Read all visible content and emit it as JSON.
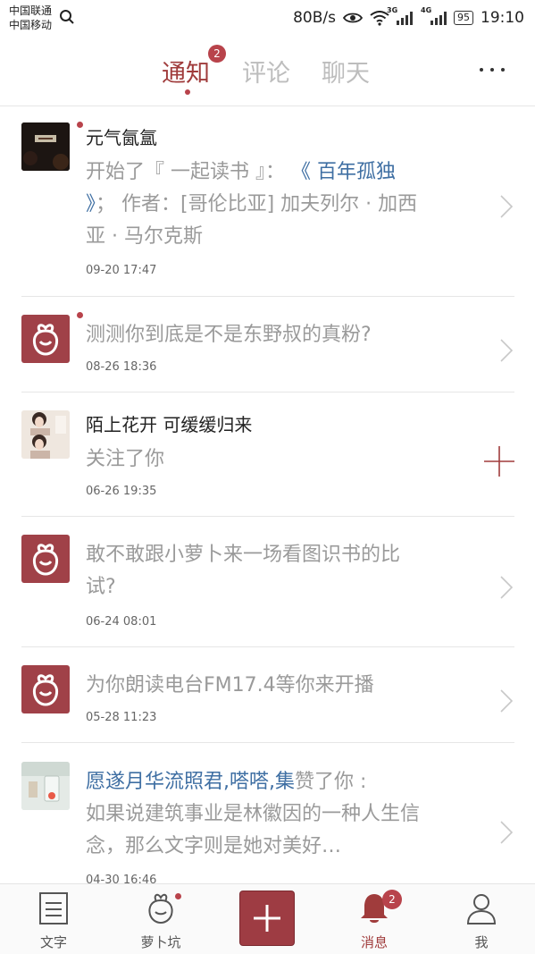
{
  "status_bar": {
    "carrier1": "中国联通",
    "carrier2": "中国移动",
    "speed": "80B/s",
    "net_3g": "3G",
    "net_4g": "4G",
    "battery": "95",
    "time": "19:10"
  },
  "tabs": {
    "notice": "通知",
    "notice_badge": "2",
    "comment": "评论",
    "chat": "聊天",
    "active": "notice"
  },
  "notifications": [
    {
      "name": "元气氤氲",
      "message_prefix": "开始了『 一起读书 』： ",
      "book": "《 百年孤独 》",
      "message_suffix": "； 作者：[哥伦比亚] 加夫列尔 · 加西亚 · 马尔克斯",
      "time": "09-20 17:47",
      "unread": true,
      "avatar": "book-cover-avatar"
    },
    {
      "message": "测测你到底是不是东野叔的真粉?",
      "time": "08-26 18:36",
      "unread": true,
      "avatar": "app-logo-avatar"
    },
    {
      "name": "陌上花开 可缓缓归来",
      "message": "关注了你",
      "time": "06-26 19:35",
      "unread": false,
      "avatar": "girl-photo-avatar",
      "action": "follow-plus"
    },
    {
      "message": "敢不敢跟小萝卜来一场看图识书的比试?",
      "time": "06-24 08:01",
      "unread": false,
      "avatar": "app-logo-avatar"
    },
    {
      "message": "为你朗读电台FM17.4等你来开播",
      "time": "05-28 11:23",
      "unread": false,
      "avatar": "app-logo-avatar"
    },
    {
      "user1": "愿遂月华流照君",
      "sep1": ",",
      "user2": "嗒嗒",
      "sep2": ",",
      "user3": "集",
      "liked": "赞了你 :",
      "message": "如果说建筑事业是林徽因的一种人生信念，那么文字则是她对美好…",
      "time": "04-30 16:46",
      "unread": false,
      "avatar": "glass-photo-avatar"
    }
  ],
  "bottom_nav": {
    "text": "文字",
    "luobokeng": "萝卜坑",
    "messages": "消息",
    "messages_badge": "2",
    "me": "我"
  },
  "colors": {
    "accent": "#a03c3c",
    "badge": "#b8434b",
    "link": "#3f6fa3",
    "muted": "#9a9a9a"
  }
}
